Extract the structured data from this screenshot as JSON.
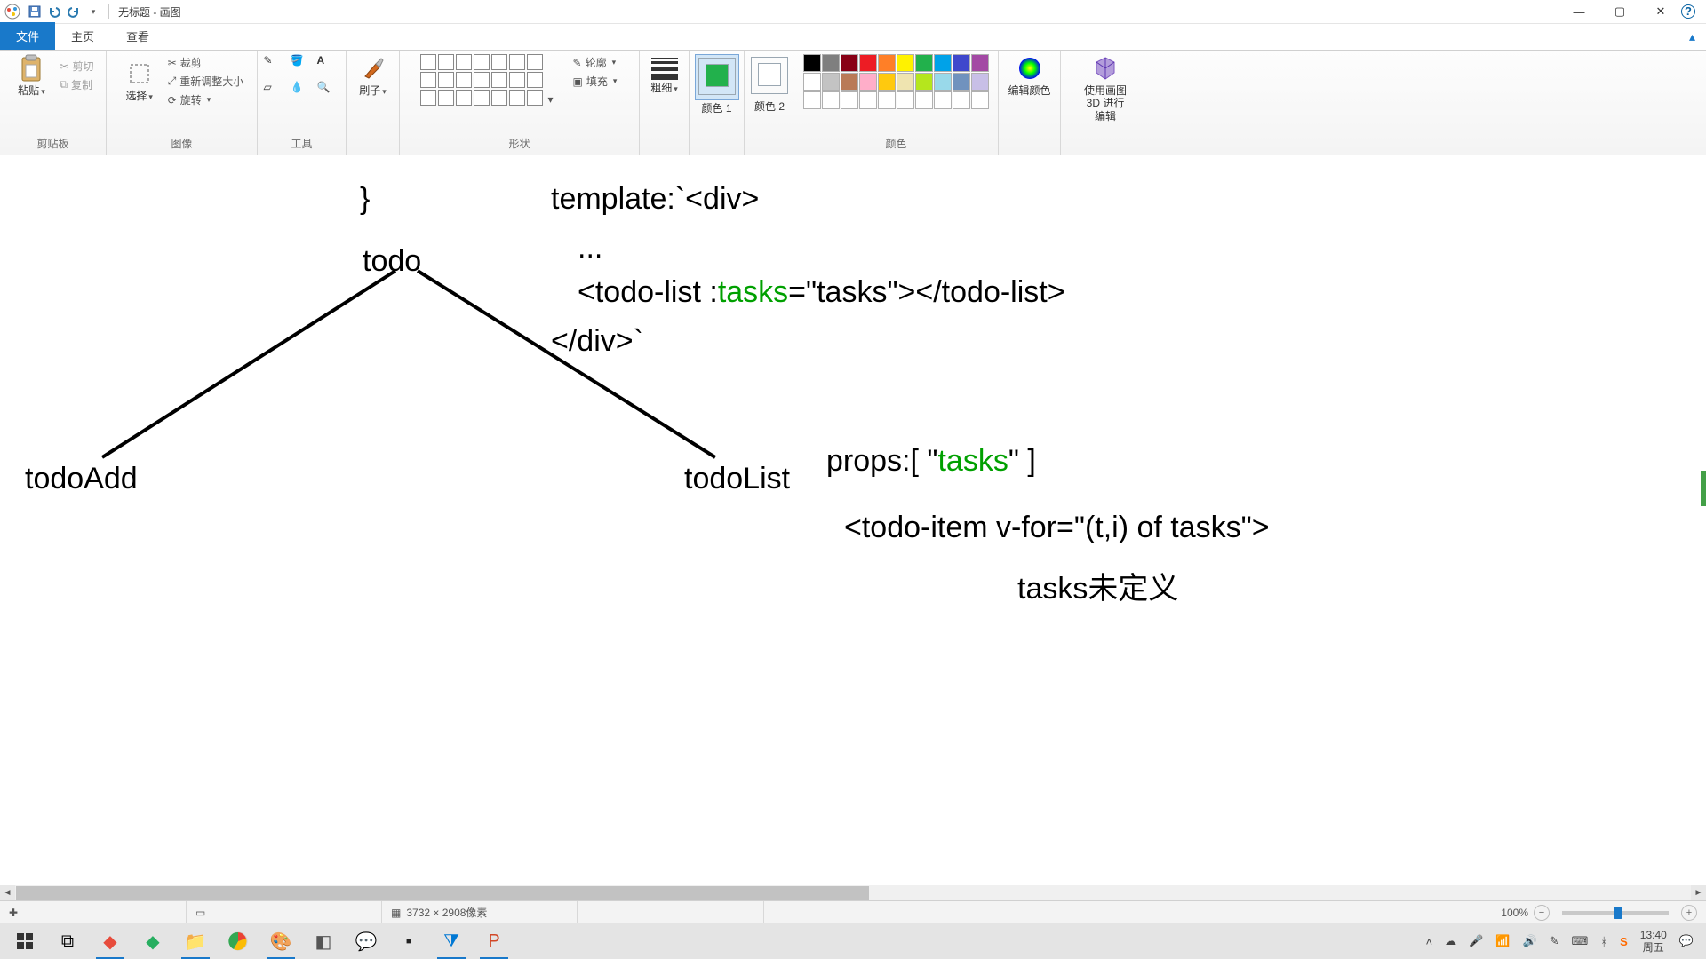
{
  "window": {
    "title": "无标题 - 画图",
    "minimize_tip": "minimize",
    "maximize_tip": "maximize",
    "close_tip": "close"
  },
  "tabs": {
    "file": "文件",
    "home": "主页",
    "view": "查看"
  },
  "ribbon": {
    "clipboard_group": "剪贴板",
    "image_group": "图像",
    "tools_group": "工具",
    "shapes_group": "形状",
    "colors_group": "颜色",
    "paste": "粘贴",
    "cut": "剪切",
    "copy": "复制",
    "select": "选择",
    "crop": "裁剪",
    "resize": "重新调整大小",
    "rotate": "旋转",
    "brushes": "刷子",
    "outline": "轮廓",
    "fill": "填充",
    "thickness": "粗细",
    "color1": "颜色 1",
    "color2": "颜色 2",
    "edit_colors": "编辑颜色",
    "paint3d": "使用画图 3D 进行编辑"
  },
  "palette_row1": [
    "#000000",
    "#7f7f7f",
    "#880015",
    "#ed1c24",
    "#ff7f27",
    "#fff200",
    "#22b14c",
    "#00a2e8",
    "#3f48cc",
    "#a349a4"
  ],
  "palette_row2": [
    "#ffffff",
    "#c3c3c3",
    "#b97a57",
    "#ffaec9",
    "#ffc90e",
    "#efe4b0",
    "#b5e61d",
    "#99d9ea",
    "#7092be",
    "#c8bfe7"
  ],
  "color1_value": "#22b14c",
  "color2_value": "#ffffff",
  "canvas": {
    "bracket": "}",
    "template_line": "template:`<div>",
    "ellipsis": "...",
    "todo": "todo",
    "todolist_line_pre": "<todo-list :",
    "todolist_tasks": "tasks",
    "todolist_line_mid": "=\"tasks\"></todo-list>",
    "closediv": "</div>`",
    "todoAdd": "todoAdd",
    "todoList": "todoList",
    "props_pre": "props:[ \"",
    "props_tasks": "tasks",
    "props_post": "\" ]",
    "vfor_line": "<todo-item v-for=\"(t,i) of tasks\">",
    "tasks_undef": "tasks未定义"
  },
  "status": {
    "canvas_size": "3732 × 2908像素",
    "zoom": "100%"
  },
  "clock": {
    "time": "13:40",
    "date": "周五"
  }
}
